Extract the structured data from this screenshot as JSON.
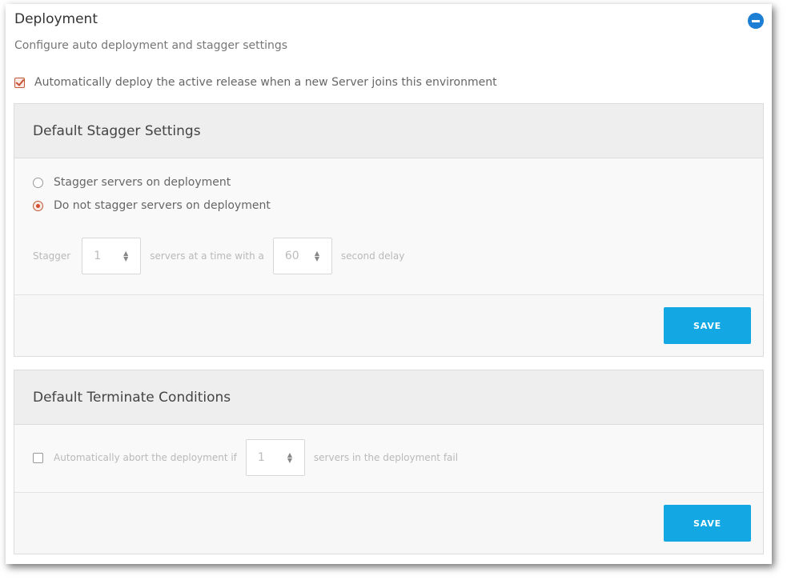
{
  "section": {
    "title": "Deployment",
    "subtitle": "Configure auto deployment and stagger settings",
    "auto_deploy_label": "Automatically deploy the active release when a new Server joins this environment",
    "auto_deploy_checked": true
  },
  "stagger": {
    "heading": "Default Stagger Settings",
    "options": [
      {
        "label": "Stagger servers on deployment",
        "selected": false
      },
      {
        "label": "Do not stagger servers on deployment",
        "selected": true
      }
    ],
    "prefix": "Stagger",
    "servers_value": "1",
    "middle": "servers at a time with a",
    "delay_value": "60",
    "suffix": "second delay",
    "save_label": "SAVE"
  },
  "terminate": {
    "heading": "Default Terminate Conditions",
    "checked": false,
    "prefix": "Automatically abort the deployment if",
    "servers_value": "1",
    "suffix": "servers in the deployment fail",
    "save_label": "SAVE"
  },
  "colors": {
    "accent_blue": "#13a8e3",
    "collapse_blue": "#1d7fd3",
    "checked_orange": "#d04f2f"
  },
  "icons": {
    "collapse": "minus-circle-icon",
    "spinner": "up-down-arrows-icon"
  }
}
